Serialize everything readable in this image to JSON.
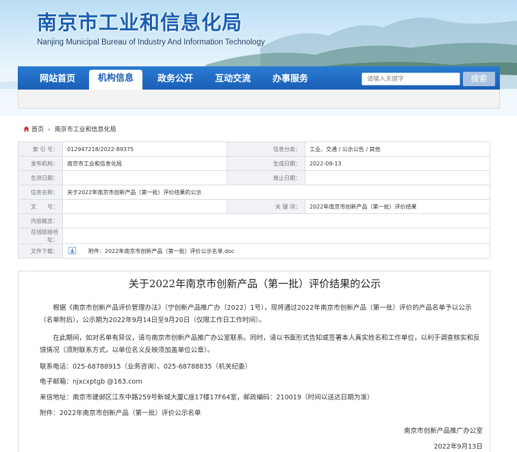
{
  "header": {
    "title": "南京市工业和信息化局",
    "subtitle": "Nanjing Municipal Bureau of Industry And Information Technology"
  },
  "nav": {
    "items": [
      {
        "label": "网站首页"
      },
      {
        "label": "机构信息",
        "active": true
      },
      {
        "label": "政务公开"
      },
      {
        "label": "互动交流"
      },
      {
        "label": "办事服务"
      }
    ],
    "search_placeholder": "请输入关键字",
    "search_button": "搜索"
  },
  "breadcrumb": {
    "home": "首页",
    "current": "南京市工业和信息化局"
  },
  "info": {
    "index_label": "索 引 号：",
    "index_value": "012947218/2022-89375",
    "category_label": "信息分类：",
    "category_value": "工业、交通 / 公示公告 / 其他",
    "publisher_label": "发布机构：",
    "publisher_value": "南京市工业和信息化局",
    "created_label": "生成日期：",
    "created_value": "2022-09-13",
    "effective_label": "生效日期：",
    "effective_value": "",
    "expiry_label": "废止日期：",
    "expiry_value": "",
    "name_label": "信息名称：",
    "name_value": "关于2022年南京市创新产品（第一批）评价结果的公示",
    "doc_label": "文　　号：",
    "doc_value": "",
    "keywords_label": "关 键 词：",
    "keywords_value": "2022年南京市创新产品（第一批）评价结果",
    "summary_label": "内容概览：",
    "summary_value": "",
    "link_label": "在线链接地址：",
    "link_value": "",
    "download_label": "文件下载：",
    "download_value": "附件：2022年南京市创新产品（第一批）评价公示名单.doc"
  },
  "article": {
    "title": "关于2022年南京市创新产品（第一批）评价结果的公示",
    "p1": "根据《南京市创新产品评价管理办法》（宁创新产品推广办〔2022〕1号），现将通过2022年南京市创新产品（第一批）评价的产品名单予以公示（名单附后），公示期为2022年9月14日至9月20日（仅限工作日工作时间）。",
    "p2": "在此期间，如对名单有异议，请与南京市创新产品推广办公室联系。同时，请以书面形式告知或签署本人真实姓名和工作单位，以利于调查核实和反馈情况（须附联系方式，以单位名义反映须加盖单位公章）。",
    "phone": "联系电话：025-68788915（业务咨询）、025-68788835（机关纪委）",
    "email": "电子邮箱：njxcxptgb @163.com",
    "address": "来信地址：南京市建邺区江东中路259号新城大厦C座17楼17F64室，邮政编码：210019（时间以送达日期为准）",
    "attachment": "附件：2022年南京市创新产品（第一批）评价公示名单",
    "signature": "南京市创新产品推广办公室",
    "date": "2022年9月13日"
  }
}
